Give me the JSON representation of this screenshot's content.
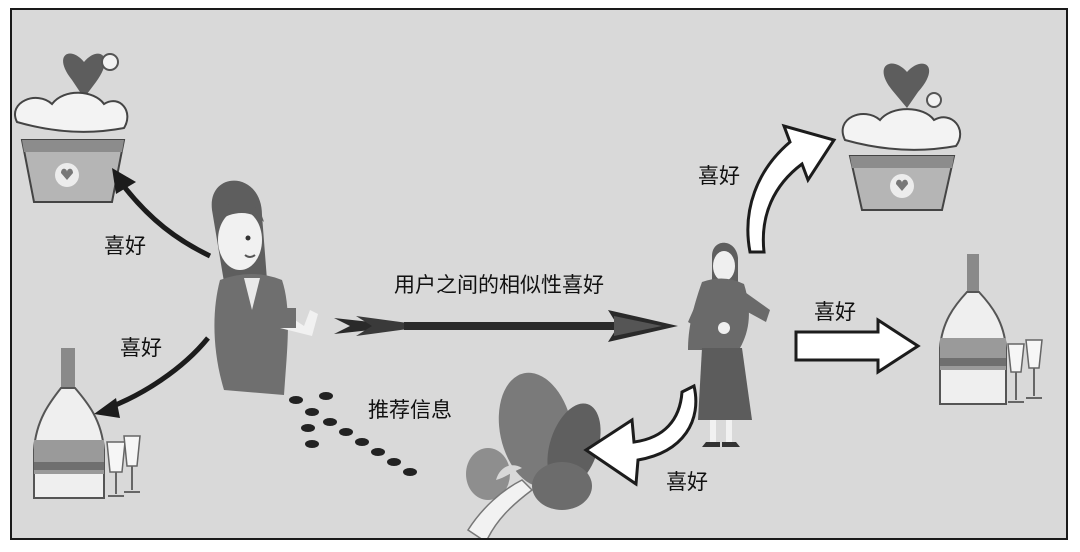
{
  "labels": {
    "left_top_preference": "喜好",
    "left_bottom_preference": "喜好",
    "similar_preference": "用户之间的相似性喜好",
    "recommend_info": "推荐信息",
    "right_top_preference": "喜好",
    "right_mid_preference": "喜好",
    "right_bottom_preference": "喜好"
  },
  "icons": {
    "left_user": "woman-user-icon",
    "right_user": "woman-user-icon",
    "dessert_left": "heart-cupcake-icon",
    "dessert_right": "heart-cupcake-icon",
    "wine_left": "wine-bottle-glasses-icon",
    "wine_right": "wine-bottle-glasses-icon",
    "food": "vegetables-icon"
  }
}
